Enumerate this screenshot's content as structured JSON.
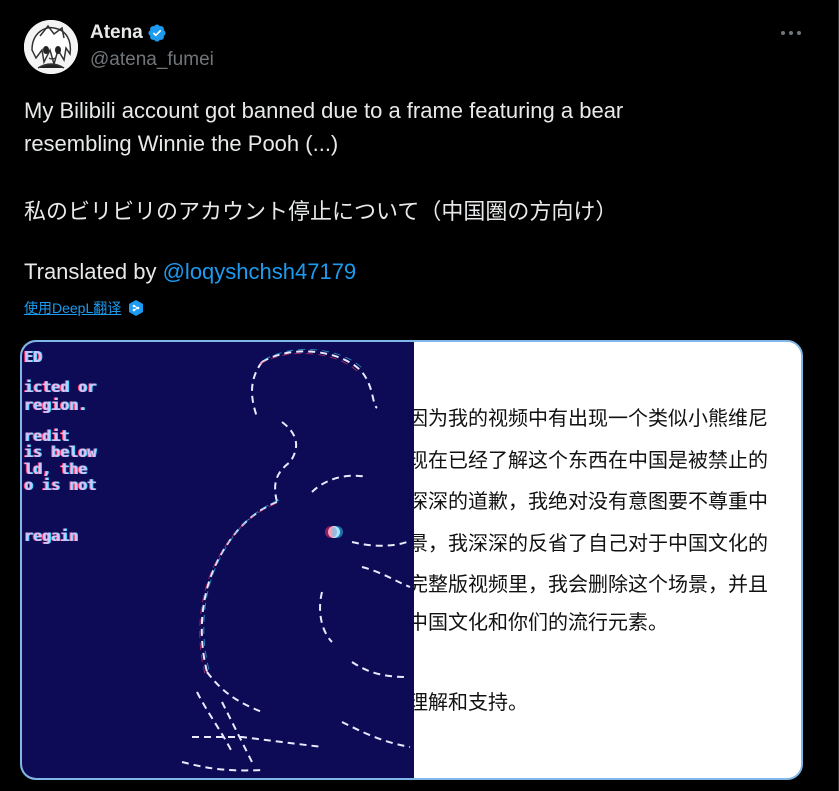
{
  "author": {
    "display_name": "Atena",
    "handle": "@atena_fumei",
    "verified_icon": "verified-badge-icon",
    "more_icon": "more-horizontal-icon"
  },
  "tweet": {
    "text_line_1": "My Bilibili account got banned due to a frame featuring a bear",
    "text_line_2": "resembling Winnie the Pooh (...)",
    "jp_line": "私のビリビリのアカウント停止について（中国圏の方向け）",
    "translated_prefix": "Translated by ",
    "translated_mention": "@loqyshchsh47179",
    "translate_link": "使用DeepL翻译",
    "translate_icon": "deepl-icon"
  },
  "media": {
    "left_lines": [
      "ED",
      "icted or",
      " region.",
      "redit",
      "  is below",
      "ld, the",
      "o is not",
      " regain"
    ],
    "right_lines": [
      "因为我的视频中有出现一个类似小熊维尼",
      "现在已经了解这个东西在中国是被禁止的",
      "深深的道歉，我绝对没有意图要不尊重中",
      "景，我深深的反省了自己对于中国文化的",
      "完整版视频里，我会删除这个场景，并且",
      "中国文化和你们的流行元素。",
      "理解和支持。"
    ]
  },
  "colors": {
    "background": "#000000",
    "text": "#e7e9ea",
    "muted": "#71767b",
    "link": "#1d9bf0",
    "media_left_bg": "#0d0b55"
  }
}
